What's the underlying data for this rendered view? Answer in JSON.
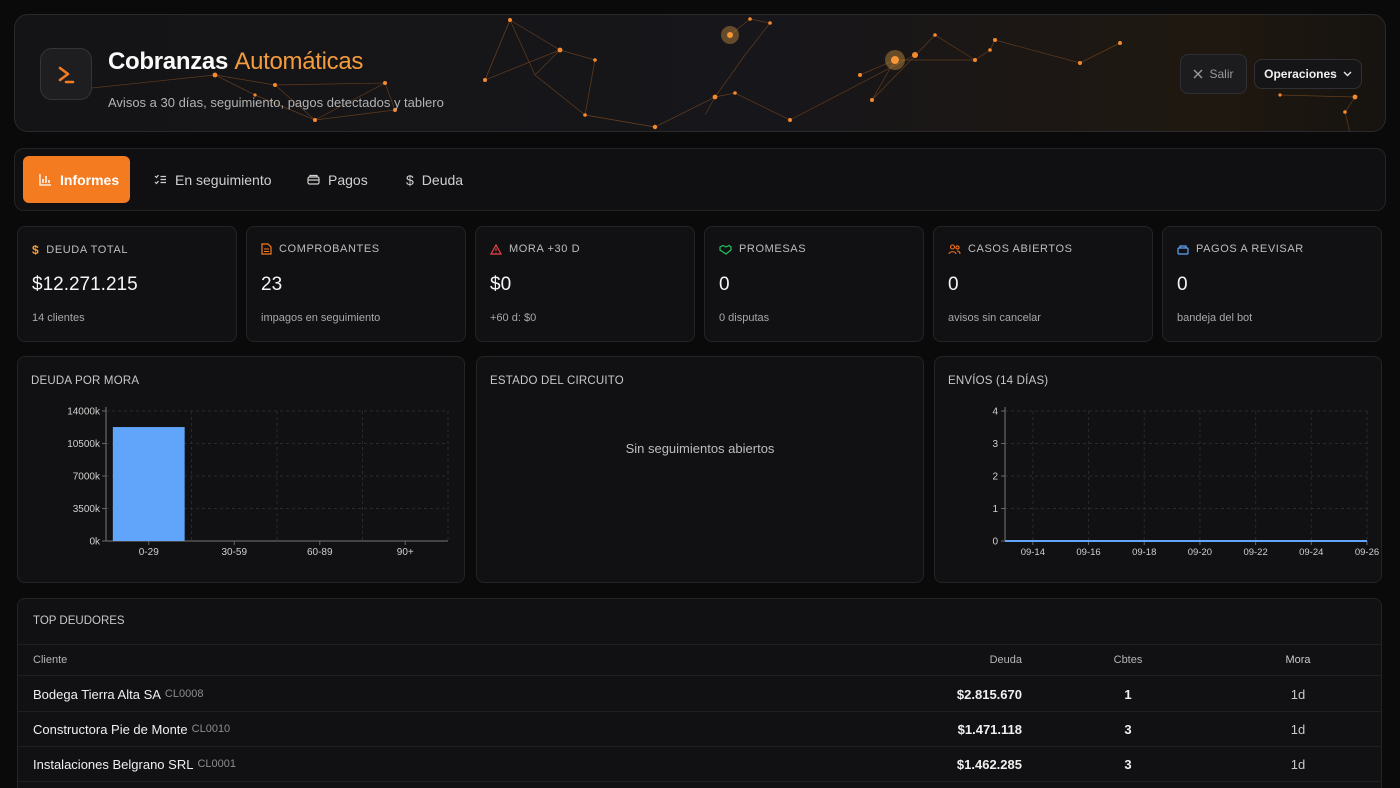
{
  "header": {
    "title_main": "Cobranzas",
    "title_accent": "Automáticas",
    "subtitle": "Avisos a 30 días, seguimiento, pagos detectados y tablero",
    "logout_label": "Salir",
    "operations_label": "Operaciones",
    "accent_color": "#f47b1f"
  },
  "tabs": [
    {
      "label": "Informes",
      "icon": "bar-chart-icon",
      "active": true
    },
    {
      "label": "En seguimiento",
      "icon": "checklist-icon",
      "active": false
    },
    {
      "label": "Pagos",
      "icon": "wallet-icon",
      "active": false
    },
    {
      "label": "Deuda",
      "icon": "dollar-icon",
      "active": false
    }
  ],
  "kpis": [
    {
      "label": "DEUDA TOTAL",
      "value": "$12.271.215",
      "sub": "14 clientes",
      "icon": "dollar-icon",
      "icon_color": "#f49c3d"
    },
    {
      "label": "COMPROBANTES",
      "value": "23",
      "sub": "impagos en seguimiento",
      "icon": "document-icon",
      "icon_color": "#f47b1f"
    },
    {
      "label": "MORA +30 D",
      "value": "$0",
      "sub": "+60 d: $0",
      "icon": "warning-icon",
      "icon_color": "#ef4444"
    },
    {
      "label": "PROMESAS",
      "value": "0",
      "sub": "0 disputas",
      "icon": "handshake-icon",
      "icon_color": "#22c55e"
    },
    {
      "label": "CASOS ABIERTOS",
      "value": "0",
      "sub": "avisos sin cancelar",
      "icon": "users-icon",
      "icon_color": "#f97316"
    },
    {
      "label": "PAGOS A REVISAR",
      "value": "0",
      "sub": "bandeja del bot",
      "icon": "inbox-icon",
      "icon_color": "#60a5fa"
    }
  ],
  "panels": {
    "debt_by_delay_title": "DEUDA POR MORA",
    "circuit_title": "ESTADO DEL CIRCUITO",
    "circuit_empty": "Sin seguimientos abiertos",
    "sends_title": "ENVÍOS (14 DÍAS)"
  },
  "chart_data": [
    {
      "type": "bar",
      "title": "DEUDA POR MORA",
      "categories": [
        "0-29",
        "30-59",
        "60-89",
        "90+"
      ],
      "values": [
        12271215,
        0,
        0,
        0
      ],
      "yticks": [
        "0k",
        "3500k",
        "7000k",
        "10500k",
        "14000k"
      ],
      "ylim": [
        0,
        14000000
      ],
      "color": "#60a5fa",
      "grid": true
    },
    {
      "type": "line",
      "title": "ENVÍOS (14 DÍAS)",
      "x": [
        "09-13",
        "09-14",
        "09-15",
        "09-16",
        "09-17",
        "09-18",
        "09-19",
        "09-20",
        "09-21",
        "09-22",
        "09-23",
        "09-24",
        "09-25",
        "09-26"
      ],
      "xticks": [
        "09-14",
        "09-16",
        "09-18",
        "09-20",
        "09-22",
        "09-24",
        "09-26"
      ],
      "values": [
        0,
        0,
        0,
        0,
        0,
        0,
        0,
        0,
        0,
        0,
        0,
        0,
        0,
        0
      ],
      "yticks": [
        "0",
        "1",
        "2",
        "3",
        "4"
      ],
      "ylim": [
        0,
        4
      ],
      "color": "#60a5fa",
      "grid": true
    }
  ],
  "top_debtors": {
    "title": "TOP DEUDORES",
    "columns": {
      "client": "Cliente",
      "debt": "Deuda",
      "vouchers": "Cbtes",
      "delay": "Mora"
    },
    "rows": [
      {
        "client": "Bodega Tierra Alta SA",
        "code": "CL0008",
        "debt": "$2.815.670",
        "vouchers": "1",
        "delay": "1d"
      },
      {
        "client": "Constructora Pie de Monte",
        "code": "CL0010",
        "debt": "$1.471.118",
        "vouchers": "3",
        "delay": "1d"
      },
      {
        "client": "Instalaciones Belgrano SRL",
        "code": "CL0001",
        "debt": "$1.462.285",
        "vouchers": "3",
        "delay": "1d"
      }
    ]
  }
}
